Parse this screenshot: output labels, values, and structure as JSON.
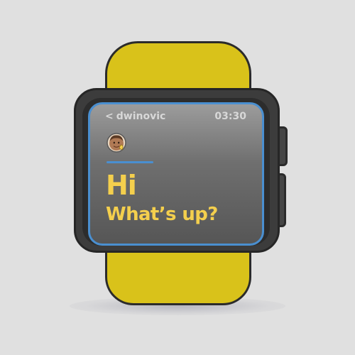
{
  "watch": {
    "contact_name": "dwinovic",
    "back_label": "<",
    "time": "03:30"
  },
  "messages": [
    "Hi",
    "What’s up?"
  ],
  "avatar": {
    "icon": "memoji-avatar-icon"
  },
  "colors": {
    "strap": "#d9c21a",
    "case": "#3c3c3c",
    "screen_border": "#4a8fd0",
    "message_text": "#f4cf4d",
    "status_text": "#d8d8d8",
    "background": "#e0e0e0"
  }
}
